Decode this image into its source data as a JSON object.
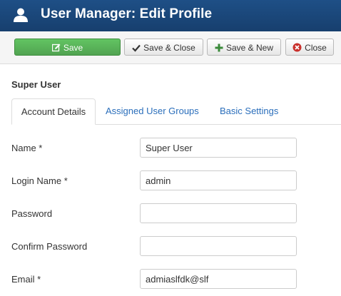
{
  "header": {
    "title": "User Manager: Edit Profile",
    "icon": "user-icon"
  },
  "toolbar": {
    "save_label": "Save",
    "save_close_label": "Save & Close",
    "save_new_label": "Save & New",
    "close_label": "Close",
    "colors": {
      "save_bg": "#51a351",
      "save_new_icon": "#3a8a3a",
      "close_icon": "#c9302c"
    }
  },
  "page": {
    "heading": "Super User"
  },
  "tabs": [
    {
      "label": "Account Details",
      "active": true
    },
    {
      "label": "Assigned User Groups",
      "active": false
    },
    {
      "label": "Basic Settings",
      "active": false
    }
  ],
  "form": {
    "fields": [
      {
        "label": "Name *",
        "value": "Super User"
      },
      {
        "label": "Login Name *",
        "value": "admin"
      },
      {
        "label": "Password",
        "value": ""
      },
      {
        "label": "Confirm Password",
        "value": ""
      },
      {
        "label": "Email *",
        "value": "admiaslfdk@slf"
      }
    ]
  }
}
